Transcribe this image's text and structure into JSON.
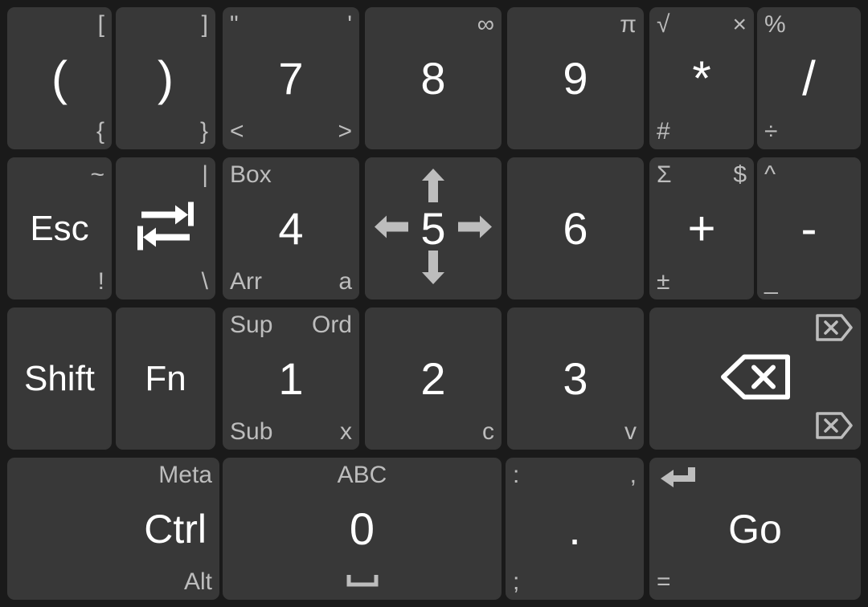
{
  "keyboard": {
    "name": "numeric-symbol-keypad",
    "colors": {
      "background": "#1a1a1a",
      "key_face": "#383838",
      "primary_text": "#ffffff",
      "secondary_text": "#bdbdbd"
    },
    "rows": [
      {
        "row": 1,
        "keys": [
          {
            "id": "paren-open",
            "main": "(",
            "tr": "[",
            "br": "{"
          },
          {
            "id": "paren-close",
            "main": ")",
            "tr": "]",
            "br": "}"
          },
          {
            "id": "digit-7",
            "main": "7",
            "tl": "\"",
            "tr": "'",
            "bl": "<",
            "br": ">"
          },
          {
            "id": "digit-8",
            "main": "8",
            "tr": "∞"
          },
          {
            "id": "digit-9",
            "main": "9",
            "tr": "π"
          },
          {
            "id": "asterisk",
            "main": "*",
            "tl": "√",
            "tr": "×",
            "bl": "#"
          },
          {
            "id": "slash",
            "main": "/",
            "tl": "%",
            "bl": "÷"
          }
        ]
      },
      {
        "row": 2,
        "keys": [
          {
            "id": "escape",
            "main": "Esc",
            "tr": "~",
            "br": "!"
          },
          {
            "id": "tab",
            "main": "",
            "icon": "tab-icon",
            "tr": "|",
            "br": "\\"
          },
          {
            "id": "digit-4",
            "main": "4",
            "tl": "Box",
            "bl": "Arr",
            "br": "a"
          },
          {
            "id": "digit-5",
            "main": "5",
            "arrows": true
          },
          {
            "id": "digit-6",
            "main": "6"
          },
          {
            "id": "plus",
            "main": "+",
            "tl": "Σ",
            "tr": "$",
            "bl": "±"
          },
          {
            "id": "minus",
            "main": "-",
            "tl": "^",
            "bl": "_"
          }
        ]
      },
      {
        "row": 3,
        "keys": [
          {
            "id": "shift",
            "main": "Shift"
          },
          {
            "id": "function",
            "main": "Fn"
          },
          {
            "id": "digit-1",
            "main": "1",
            "tl": "Sup",
            "tr": "Ord",
            "bl": "Sub",
            "br": "x"
          },
          {
            "id": "digit-2",
            "main": "2",
            "br": "c"
          },
          {
            "id": "digit-3",
            "main": "3",
            "br": "v"
          },
          {
            "id": "backspace",
            "main": "",
            "icon": "backspace-icon",
            "icon_tr": "delete-forward-icon",
            "icon_br": "delete-forward-icon"
          }
        ]
      },
      {
        "row": 4,
        "keys": [
          {
            "id": "control",
            "main": "Ctrl",
            "tr": "Meta",
            "br": "Alt"
          },
          {
            "id": "digit-0",
            "main": "0",
            "tc": "ABC",
            "icon_bc": "space-icon"
          },
          {
            "id": "period",
            "main": ".",
            "tl": ":",
            "tr": ",",
            "bl": ";"
          },
          {
            "id": "go",
            "main": "Go",
            "icon_tl": "enter-icon",
            "bl": "="
          }
        ]
      }
    ]
  }
}
